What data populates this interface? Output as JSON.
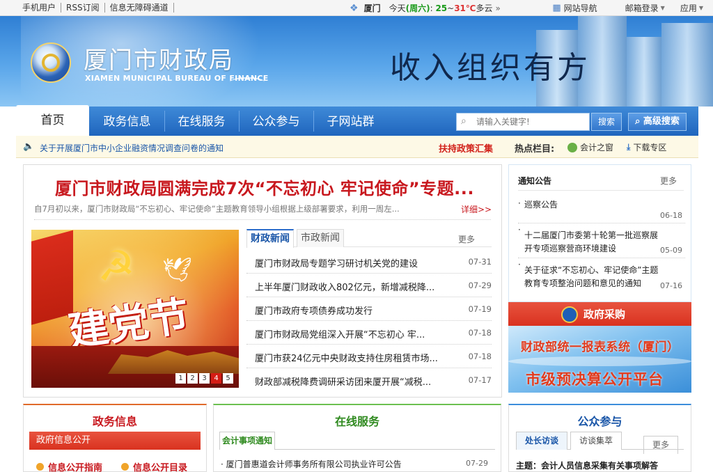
{
  "topbar": {
    "links": [
      "手机用户",
      "RSS订阅",
      "信息无障碍通道"
    ],
    "weather": {
      "city": "厦门",
      "today": "今天",
      "weekday": "(周六)",
      "low": "25",
      "sep": "~",
      "high": "31℃",
      "desc": "多云",
      "arrow": "»"
    },
    "site_nav": "网站导航",
    "mail": "邮箱登录",
    "apps": "应用"
  },
  "banner": {
    "title_cn": "厦门市财政局",
    "title_en": "XIAMEN MUNICIPAL BUREAU OF FINANCE",
    "slogan": "收入组织有方"
  },
  "nav": {
    "items": [
      "首页",
      "政务信息",
      "在线服务",
      "公众参与",
      "子网站群"
    ],
    "search_placeholder": "请输入关键字!",
    "search_button": "搜索",
    "advanced_button": "高级搜索"
  },
  "notice": {
    "text": "关于开展厦门市中小企业融资情况调查问卷的通知",
    "policy": "扶持政策汇集",
    "hot_label": "热点栏目:",
    "accounting": "会计之窗",
    "download": "下载专区"
  },
  "feature": {
    "headline": "厦门市财政局圆满完成7次“不忘初心 牢记使命”专题...",
    "summary": "自7月初以来，厦门市财政局“不忘初心、牢记使命”主题教育领导小组根据上级部署要求，利用一周左...",
    "detail_link": "详细>>",
    "photo_caption": "建党节",
    "pager": [
      "1",
      "2",
      "3",
      "4",
      "5"
    ]
  },
  "news": {
    "tabs": [
      "财政新闻",
      "市政新闻"
    ],
    "more": "更多",
    "items": [
      {
        "title": "厦门市财政局专题学习研讨机关党的建设",
        "date": "07-31"
      },
      {
        "title": "上半年厦门财政收入802亿元，新增减税降...",
        "date": "07-29"
      },
      {
        "title": "厦门市政府专项债券成功发行",
        "date": "07-19"
      },
      {
        "title": "厦门市财政局党组深入开展“不忘初心 牢...",
        "date": "07-18"
      },
      {
        "title": "厦门市获24亿元中央财政支持住房租赁市场...",
        "date": "07-18"
      },
      {
        "title": "财政部减税降费调研采访团来厦开展“减税...",
        "date": "07-17"
      }
    ]
  },
  "announcements": {
    "title": "通知公告",
    "more": "更多",
    "items": [
      {
        "title": "巡察公告",
        "date": "06-18"
      },
      {
        "title": "十二届厦门市委第十轮第一批巡察展开专项巡察营商环境建设",
        "date": "05-09"
      },
      {
        "title": "关于征求“不忘初心、牢记使命”主题教育专项整治问题和意见的通知",
        "date": "07-16"
      }
    ]
  },
  "procurement": "政府采购",
  "promo": {
    "line1": "财政部统一报表系统（厦门）",
    "line2": "市级预决算公开平台"
  },
  "col_gov": {
    "title": "政务信息",
    "sub": "政府信息公开",
    "links": [
      "信息公开指南",
      "信息公开目录"
    ]
  },
  "col_service": {
    "title": "在线服务",
    "tab": "会计事项通知",
    "item": "厦门普惠道会计师事务所有限公司执业许可公告",
    "date": "07-29"
  },
  "col_public": {
    "title": "公众参与",
    "tabs": [
      "处长访谈",
      "访谈集萃"
    ],
    "more": "更多",
    "topic": "主题：会计人员信息采集有关事项解答"
  }
}
